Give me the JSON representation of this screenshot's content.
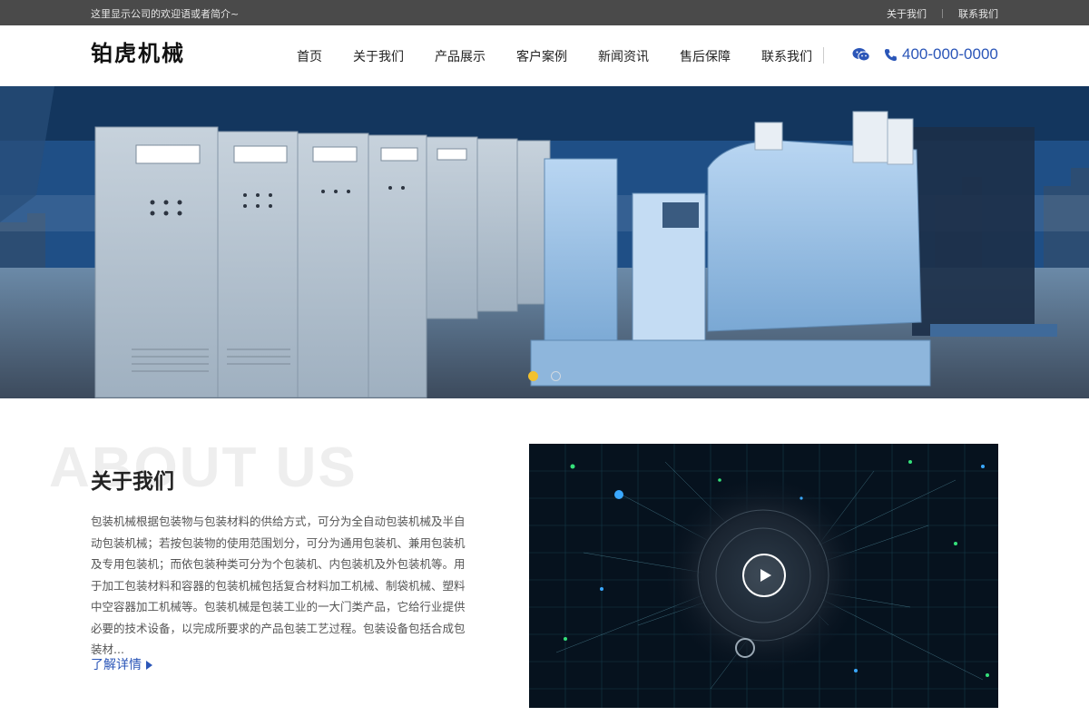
{
  "topbar": {
    "welcome": "这里显示公司的欢迎语或者简介~",
    "links": [
      "关于我们",
      "联系我们"
    ]
  },
  "header": {
    "logo": "铂虎机械",
    "nav": [
      "首页",
      "关于我们",
      "产品展示",
      "客户案例",
      "新闻资讯",
      "售后保障",
      "联系我们"
    ],
    "phone": "400-000-0000",
    "icons": [
      "wechat-icon",
      "phone-icon"
    ],
    "accent_color": "#2b56b8"
  },
  "banner": {
    "slide_count": 2,
    "active_slide": 1,
    "active_dot_color": "#f2c12e"
  },
  "about": {
    "bg_text": "ABOUT US",
    "title": "关于我们",
    "body": "包装机械根据包装物与包装材料的供给方式，可分为全自动包装机械及半自动包装机械；若按包装物的使用范围划分，可分为通用包装机、兼用包装机及专用包装机；而依包装种类可分为个包装机、内包装机及外包装机等。用于加工包装材料和容器的包装机械包括复合材料加工机械、制袋机械、塑料中空容器加工机械等。包装机械是包装工业的一大门类产品，它给行业提供必要的技术设备，以完成所要求的产品包装工艺过程。包装设备包括合成包装材...",
    "more_label": "了解详情"
  },
  "video": {
    "icon": "play-icon"
  }
}
